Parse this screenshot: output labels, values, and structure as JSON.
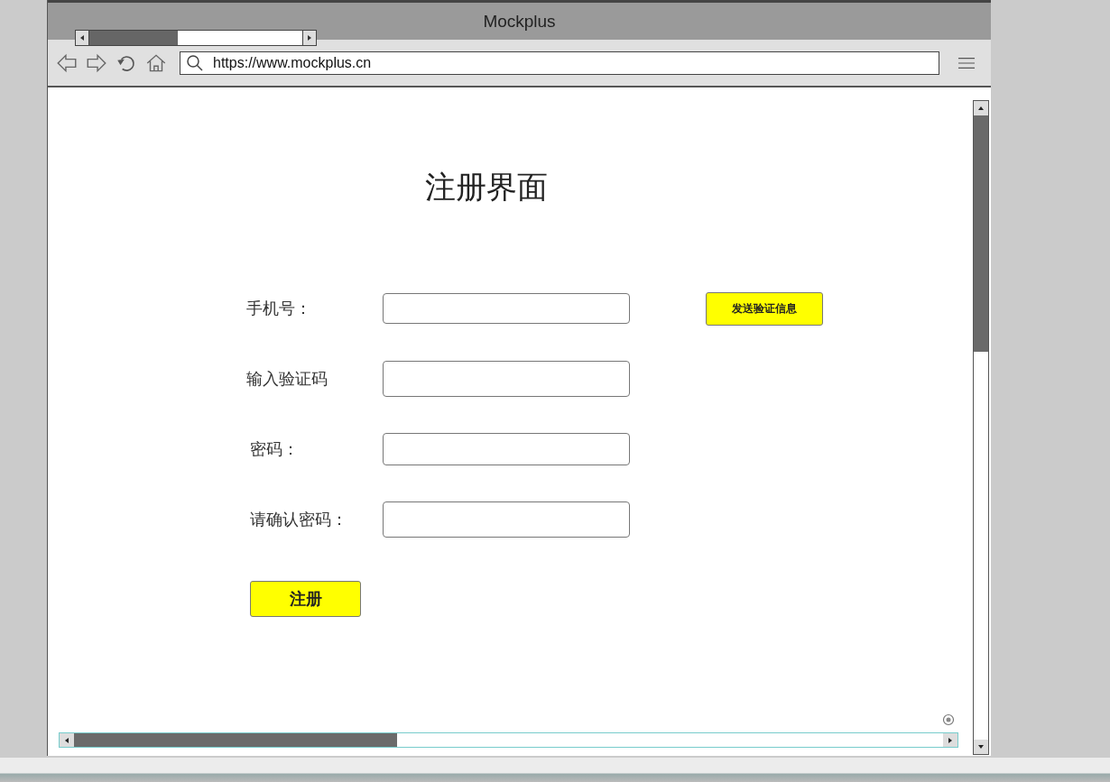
{
  "window": {
    "title": "Mockplus"
  },
  "address_bar": {
    "url": "https://www.mockplus.cn"
  },
  "page": {
    "heading": "注册界面",
    "fields": [
      {
        "label": "手机号：",
        "kind": "with_button",
        "button": "发送验证信息"
      },
      {
        "label": "输入验证码",
        "kind": "plain"
      },
      {
        "label": "密码：",
        "kind": "plain"
      },
      {
        "label": "请确认密码：",
        "kind": "plain"
      }
    ],
    "submit_button": "注册"
  }
}
